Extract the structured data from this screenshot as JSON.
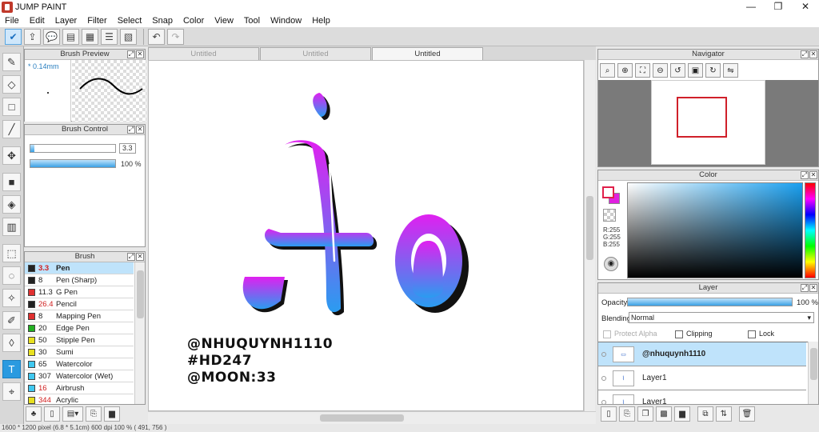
{
  "app": {
    "title": "JUMP PAINT"
  },
  "window_controls": {
    "minimize": "—",
    "maximize": "❐",
    "close": "✕"
  },
  "menu": [
    "File",
    "Edit",
    "Layer",
    "Filter",
    "Select",
    "Snap",
    "Color",
    "View",
    "Tool",
    "Window",
    "Help"
  ],
  "brush_preview": {
    "title": "Brush Preview",
    "size": "* 0.14mm"
  },
  "brush_control": {
    "title": "Brush Control",
    "size_value": "3.3",
    "opacity_value": "100 %",
    "size_fraction": 0.05,
    "opacity_fraction": 1.0
  },
  "brush_panel": {
    "title": "Brush",
    "items": [
      {
        "size": "3.3",
        "name": "Pen",
        "color": "#222222",
        "size_red": true,
        "selected": true
      },
      {
        "size": "8",
        "name": "Pen (Sharp)",
        "color": "#222222",
        "size_red": false,
        "selected": false
      },
      {
        "size": "11.3",
        "name": "G Pen",
        "color": "#e03030",
        "size_red": false,
        "selected": false
      },
      {
        "size": "26.4",
        "name": "Pencil",
        "color": "#222222",
        "size_red": true,
        "selected": false
      },
      {
        "size": "8",
        "name": "Mapping Pen",
        "color": "#e03030",
        "size_red": false,
        "selected": false
      },
      {
        "size": "20",
        "name": "Edge Pen",
        "color": "#22b022",
        "size_red": false,
        "selected": false
      },
      {
        "size": "50",
        "name": "Stipple Pen",
        "color": "#e8e020",
        "size_red": false,
        "selected": false
      },
      {
        "size": "30",
        "name": "Sumi",
        "color": "#e8e020",
        "size_red": false,
        "selected": false
      },
      {
        "size": "65",
        "name": "Watercolor",
        "color": "#40c8f0",
        "size_red": false,
        "selected": false
      },
      {
        "size": "307",
        "name": "Watercolor (Wet)",
        "color": "#40c8f0",
        "size_red": false,
        "selected": false
      },
      {
        "size": "16",
        "name": "Airbrush",
        "color": "#40c8f0",
        "size_red": true,
        "selected": false
      },
      {
        "size": "344",
        "name": "Acrylic",
        "color": "#e8e020",
        "size_red": true,
        "selected": false
      }
    ]
  },
  "tabs": [
    {
      "label": "Untitled",
      "active": false
    },
    {
      "label": "Untitled",
      "active": false
    },
    {
      "label": "Untitled",
      "active": true
    }
  ],
  "canvas": {
    "watermark": [
      "@NHUQUYNH1110",
      "#HD247",
      "@MOON:33"
    ],
    "artwork_gradient": [
      "#e020f0",
      "#2a9cf0"
    ]
  },
  "navigator": {
    "title": "Navigator"
  },
  "color_panel": {
    "title": "Color",
    "r": "R:255",
    "g": "G:255",
    "b": "B:255",
    "foreground": "#ffffff",
    "background": "#e020e0"
  },
  "layer_panel": {
    "title": "Layer",
    "opacity_label": "Opacity",
    "opacity_value": "100 %",
    "opacity_fraction": 1.0,
    "blending_label": "Blending",
    "blending_value": "Normal",
    "protect_alpha": "Protect Alpha",
    "clipping": "Clipping",
    "lock": "Lock",
    "layers": [
      {
        "name": "@nhuquynh1110",
        "selected": true
      },
      {
        "name": "Layer1",
        "selected": false
      },
      {
        "name": "Layer1",
        "selected": false
      }
    ]
  },
  "status": "1600 * 1200 pixel  (6.8 * 5.1cm)  600 dpi  100 %  ( 491, 756 )"
}
